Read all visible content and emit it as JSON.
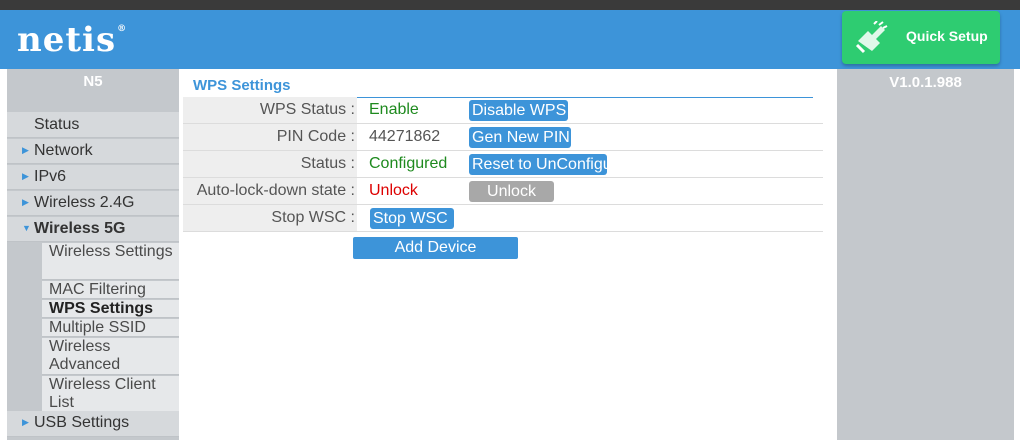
{
  "header": {
    "logo": "netis",
    "logo_mark": "®",
    "quick_setup_label": "Quick Setup",
    "quick_setup_icon": "hand-pointer-icon"
  },
  "sidebar": {
    "model": "N5",
    "items": [
      {
        "label": "Status",
        "has_arrow": false
      },
      {
        "label": "Network",
        "has_arrow": true
      },
      {
        "label": "IPv6",
        "has_arrow": true
      },
      {
        "label": "Wireless 2.4G",
        "has_arrow": true
      },
      {
        "label": "Wireless 5G",
        "has_arrow": true,
        "expanded": true
      }
    ],
    "subitems": [
      {
        "label": "Wireless Settings"
      },
      {
        "label": "MAC Filtering"
      },
      {
        "label": "WPS Settings",
        "current": true
      },
      {
        "label": "Multiple SSID"
      },
      {
        "label": "Wireless Advanced"
      },
      {
        "label": "Wireless Client List"
      }
    ],
    "usb": {
      "label": "USB Settings"
    }
  },
  "version": "V1.0.1.988",
  "wps": {
    "title": "WPS Settings",
    "rows": [
      {
        "label": "WPS Status :",
        "value": "Enable",
        "button": "Disable WPS"
      },
      {
        "label": "PIN Code :",
        "value": "44271862",
        "button": "Gen New PIN"
      },
      {
        "label": "Status :",
        "value": "Configured",
        "button": "Reset to UnConfigu"
      },
      {
        "label": "Auto-lock-down state :",
        "value": "Unlock",
        "button": "Unlock"
      },
      {
        "label": "Stop WSC :",
        "button": "Stop WSC"
      }
    ],
    "add_device": "Add Device"
  },
  "colors": {
    "brand_blue": "#3d94d9",
    "quick_setup_green": "#2ecc71",
    "value_green": "#1e8a1e",
    "unlock_red": "#dd0000"
  }
}
